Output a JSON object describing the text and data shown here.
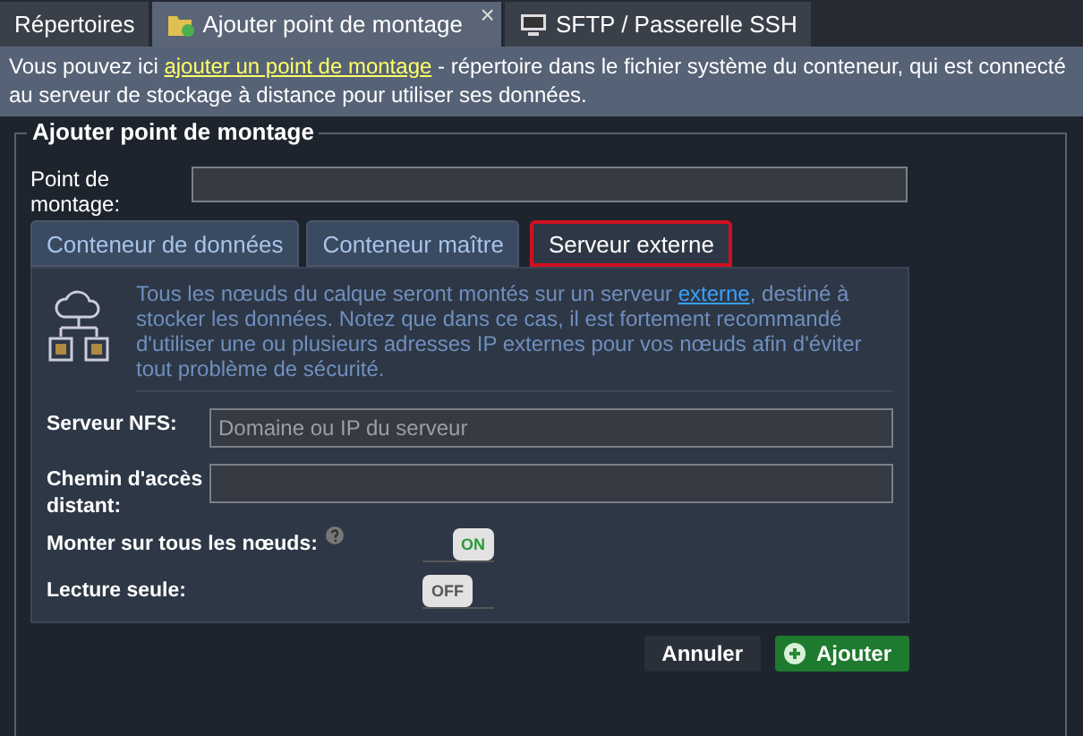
{
  "tabs": [
    {
      "label": "Répertoires",
      "selected": false
    },
    {
      "label": "Ajouter point de montage",
      "selected": true,
      "close": "×"
    },
    {
      "label": "SFTP / Passerelle SSH",
      "selected": false
    }
  ],
  "info": {
    "before": "Vous pouvez ici ",
    "link": "ajouter un point de montage",
    "after": " - répertoire dans le fichier système du conteneur, qui est connecté au serveur de stockage à distance pour utiliser ses données."
  },
  "form": {
    "legend": "Ajouter point de montage",
    "mount_point": {
      "label": "Point de montage:"
    },
    "source_tabs": [
      {
        "label": "Conteneur de données",
        "selected": false
      },
      {
        "label": "Conteneur maître",
        "selected": false
      },
      {
        "label": "Serveur externe",
        "selected": true
      }
    ],
    "description": {
      "before": "Tous les nœuds du calque seront montés sur un serveur ",
      "link": "externe",
      "after": ", destiné à stocker les données. Notez que dans ce cas, il est fortement recommandé d'utiliser une ou plusieurs adresses IP externes pour vos nœuds afin d'éviter tout problème de sécurité."
    },
    "fields": [
      {
        "label": "Serveur NFS:",
        "placeholder": "Domaine ou IP du serveur"
      },
      {
        "label": "Chemin d'accès distant:"
      }
    ],
    "toggles": [
      {
        "label": "Monter sur tous les nœuds:",
        "on": true,
        "text": "ON"
      },
      {
        "label": "Lecture seule:",
        "on": false,
        "text": "OFF"
      }
    ],
    "buttons": [
      {
        "label": "Annuler",
        "kind": "secondary"
      },
      {
        "label": "Ajouter",
        "kind": "primary"
      }
    ]
  }
}
